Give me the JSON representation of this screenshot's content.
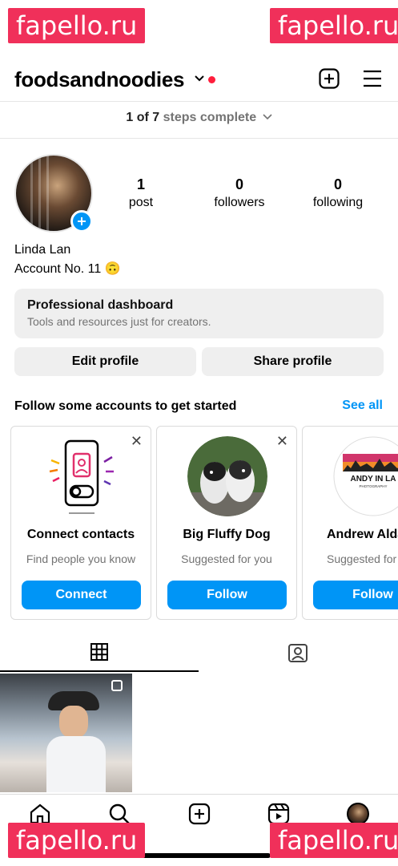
{
  "watermark": "fapello.ru",
  "header": {
    "username": "foodsandnoodies"
  },
  "steps": {
    "count": "1 of 7",
    "label": "steps complete"
  },
  "profile": {
    "name": "Linda Lan",
    "bio": "Account No. 11 🙃"
  },
  "stats": [
    {
      "value": "1",
      "label": "post"
    },
    {
      "value": "0",
      "label": "followers"
    },
    {
      "value": "0",
      "label": "following"
    }
  ],
  "dashboard": {
    "title": "Professional dashboard",
    "subtitle": "Tools and resources just for creators."
  },
  "buttons": {
    "edit": "Edit profile",
    "share": "Share profile"
  },
  "suggestions": {
    "title": "Follow some accounts to get started",
    "see_all": "See all",
    "cards": [
      {
        "title": "Connect contacts",
        "subtitle": "Find people you know",
        "action": "Connect"
      },
      {
        "title": "Big Fluffy Dog",
        "subtitle": "Suggested for you",
        "action": "Follow"
      },
      {
        "title": "Andrew Alda",
        "subtitle": "Suggested for you",
        "action": "Follow",
        "logo_text": "ANDY IN LA",
        "logo_sub": "PHOTOGRAPHY"
      }
    ]
  },
  "colors": {
    "accent": "#0095f6",
    "notification": "#ff1e3c",
    "watermark": "#f0305a"
  }
}
